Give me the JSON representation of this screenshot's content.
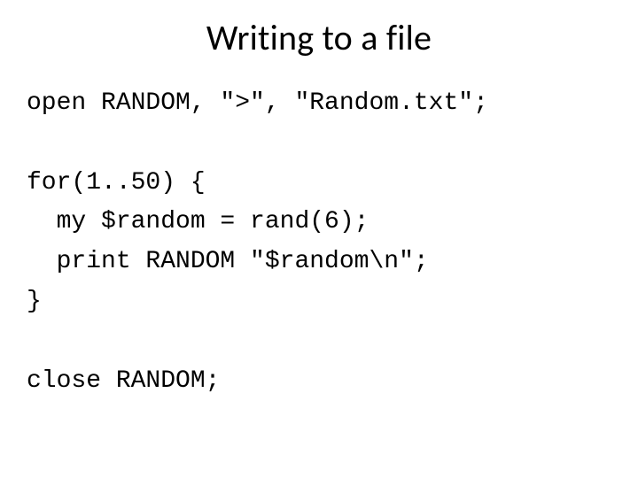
{
  "title": "Writing to a file",
  "code": {
    "line1": "open RANDOM, \">\", \"Random.txt\";",
    "blank1": "",
    "line2": "for(1..50) {",
    "line3": "  my $random = rand(6);",
    "line4": "  print RANDOM \"$random\\n\";",
    "line5": "}",
    "blank2": "",
    "line6": "close RANDOM;"
  }
}
